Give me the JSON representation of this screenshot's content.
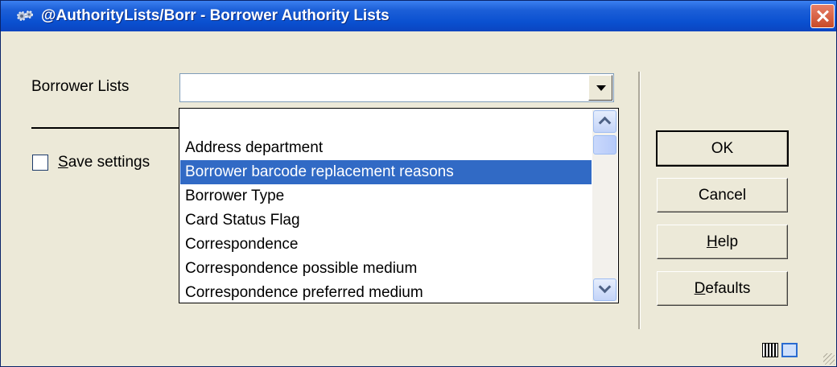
{
  "window": {
    "title": "@AuthorityLists/Borr - Borrower Authority Lists",
    "title_bar_color": "#0a50d0",
    "app_icon": "gears-icon",
    "close_icon": "close-icon"
  },
  "form": {
    "borrower_lists_label": "Borrower Lists",
    "borrower_lists_value": "",
    "save_settings_prefix": "",
    "save_settings_mnemonic": "S",
    "save_settings_rest": "ave settings",
    "save_settings_checked": false
  },
  "dropdown": {
    "items": [
      "Address department",
      "Borrower barcode replacement reasons",
      "Borrower Type",
      "Card Status Flag",
      "Correspondence",
      "Correspondence possible medium",
      "Correspondence preferred medium"
    ],
    "selected_index": 1,
    "selected_value": "Borrower barcode replacement reasons",
    "selection_color": "#316ac5"
  },
  "buttons": {
    "ok": {
      "label": "OK"
    },
    "cancel": {
      "label": "Cancel"
    },
    "help": {
      "prefix": "",
      "mnemonic": "H",
      "rest": "elp"
    },
    "defaults": {
      "prefix": "",
      "mnemonic": "D",
      "rest": "efaults"
    }
  },
  "status_bar": {
    "icons": [
      "keyboard-grid-icon",
      "expand-icon",
      "resize-grip-icon"
    ]
  }
}
